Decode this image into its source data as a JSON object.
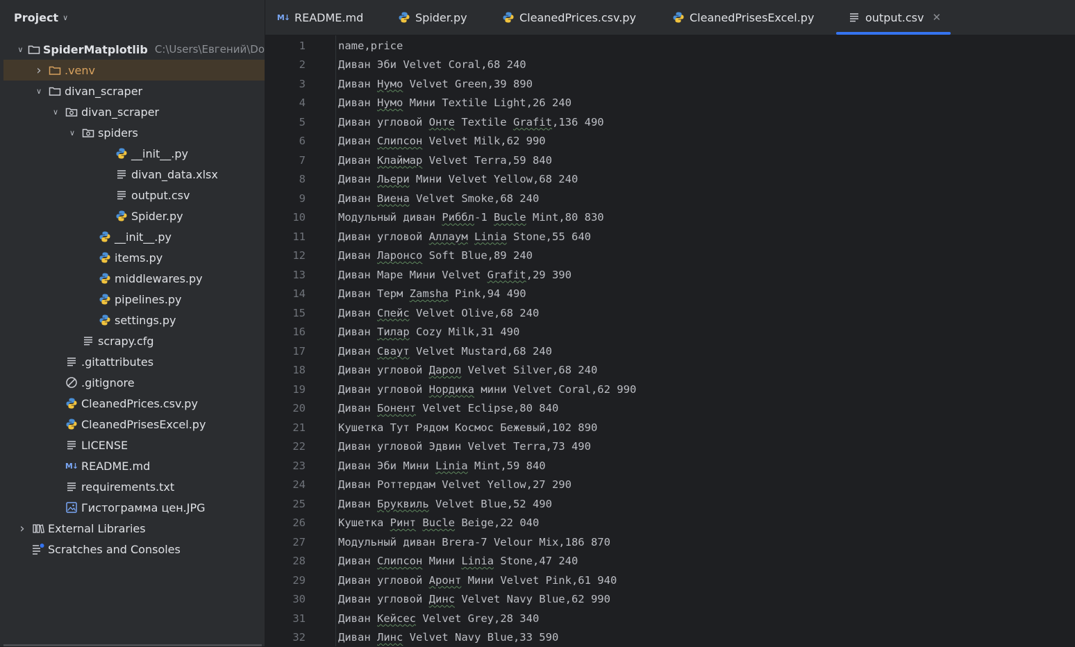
{
  "project": {
    "title": "Project",
    "root": {
      "name": "SpiderMatplotlib",
      "path": "C:\\Users\\Евгений\\Do"
    },
    "tree": [
      {
        "label": ".venv",
        "depth": 1,
        "type": "folder",
        "expanded": false,
        "excluded": true,
        "selected": true
      },
      {
        "label": "divan_scraper",
        "depth": 1,
        "type": "folder",
        "expanded": true
      },
      {
        "label": "divan_scraper",
        "depth": 2,
        "type": "package",
        "expanded": true
      },
      {
        "label": "spiders",
        "depth": 3,
        "type": "package",
        "expanded": true
      },
      {
        "label": "__init__.py",
        "depth": 5,
        "type": "python"
      },
      {
        "label": "divan_data.xlsx",
        "depth": 5,
        "type": "text"
      },
      {
        "label": "output.csv",
        "depth": 5,
        "type": "text"
      },
      {
        "label": "Spider.py",
        "depth": 5,
        "type": "python"
      },
      {
        "label": "__init__.py",
        "depth": 4,
        "type": "python"
      },
      {
        "label": "items.py",
        "depth": 4,
        "type": "python"
      },
      {
        "label": "middlewares.py",
        "depth": 4,
        "type": "python"
      },
      {
        "label": "pipelines.py",
        "depth": 4,
        "type": "python"
      },
      {
        "label": "settings.py",
        "depth": 4,
        "type": "python"
      },
      {
        "label": "scrapy.cfg",
        "depth": 3,
        "type": "text"
      },
      {
        "label": ".gitattributes",
        "depth": 2,
        "type": "text"
      },
      {
        "label": ".gitignore",
        "depth": 2,
        "type": "ignore"
      },
      {
        "label": "CleanedPrices.csv.py",
        "depth": 2,
        "type": "python"
      },
      {
        "label": "CleanedPrisesExcel.py",
        "depth": 2,
        "type": "python"
      },
      {
        "label": "LICENSE",
        "depth": 2,
        "type": "text"
      },
      {
        "label": "README.md",
        "depth": 2,
        "type": "markdown"
      },
      {
        "label": "requirements.txt",
        "depth": 2,
        "type": "text"
      },
      {
        "label": "Гистограмма цен.JPG",
        "depth": 2,
        "type": "image"
      },
      {
        "label": "External Libraries",
        "depth": 0,
        "type": "library",
        "expanded": false
      },
      {
        "label": "Scratches and Consoles",
        "depth": 0,
        "type": "scratch"
      }
    ]
  },
  "tabs": [
    {
      "label": "README.md",
      "icon": "markdown-icon",
      "active": false
    },
    {
      "label": "Spider.py",
      "icon": "python-icon",
      "active": false
    },
    {
      "label": "CleanedPrices.csv.py",
      "icon": "python-icon",
      "active": false
    },
    {
      "label": "CleanedPrisesExcel.py",
      "icon": "python-icon",
      "active": false
    },
    {
      "label": "output.csv",
      "icon": "text-file-icon",
      "active": true,
      "close": "✕"
    }
  ],
  "editor": {
    "lines": [
      "name,price",
      "Диван Эби Velvet Coral,68 240",
      "Диван Нумо Velvet Green,39 890",
      "Диван Нумо Мини Textile Light,26 240",
      "Диван угловой Онте Textile Grafit,136 490",
      "Диван Слипсон Velvet Milk,62 990",
      "Диван Клаймар Velvet Terra,59 840",
      "Диван Льери Мини Velvet Yellow,68 240",
      "Диван Виена Velvet Smoke,68 240",
      "Модульный диван Риббл-1 Bucle Mint,80 830",
      "Диван угловой Аллаум Linia Stone,55 640",
      "Диван Ларонсо Soft Blue,89 240",
      "Диван Маре Мини Velvet Grafit,29 390",
      "Диван Терм Zamsha Pink,94 490",
      "Диван Спейс Velvet Olive,68 240",
      "Диван Тилар Cozy Milk,31 490",
      "Диван Сваут Velvet Mustard,68 240",
      "Диван угловой Дарол Velvet Silver,68 240",
      "Диван угловой Нордика мини Velvet Coral,62 990",
      "Диван Бонент Velvet Eclipse,80 840",
      "Кушетка Тут Рядом Космос Бежевый,102 890",
      "Диван угловой Эдвин Velvet Terra,73 490",
      "Диван Эби Мини Linia Mint,59 840",
      "Диван Роттердам Velvet Yellow,27 290",
      "Диван Бруквиль Velvet Blue,52 490",
      "Кушетка Ринт Bucle Beige,22 040",
      "Модульный диван Brera-7 Velour Mix,186 870",
      "Диван Слипсон Мини Linia Stone,47 240",
      "Диван угловой Аронт Мини Velvet Pink,61 940",
      "Диван угловой Динс Velvet Navy Blue,62 990",
      "Диван Кейсес Velvet Grey,28 340",
      "Диван Линс Velvet Navy Blue,33 590"
    ],
    "underlined_words": [
      "Нумо",
      "Онте",
      "Grafit",
      "Слипсон",
      "Клаймар",
      "Льери",
      "Виена",
      "Риббл",
      "Bucle",
      "Аллаум",
      "Linia",
      "Ларонсо",
      "Zamsha",
      "Спейс",
      "Тилар",
      "Сваут",
      "Дарол",
      "Нордика",
      "Бонент",
      "Бруквиль",
      "Ринт",
      "Аронт",
      "Динс",
      "Кейсес",
      "Линс"
    ]
  }
}
